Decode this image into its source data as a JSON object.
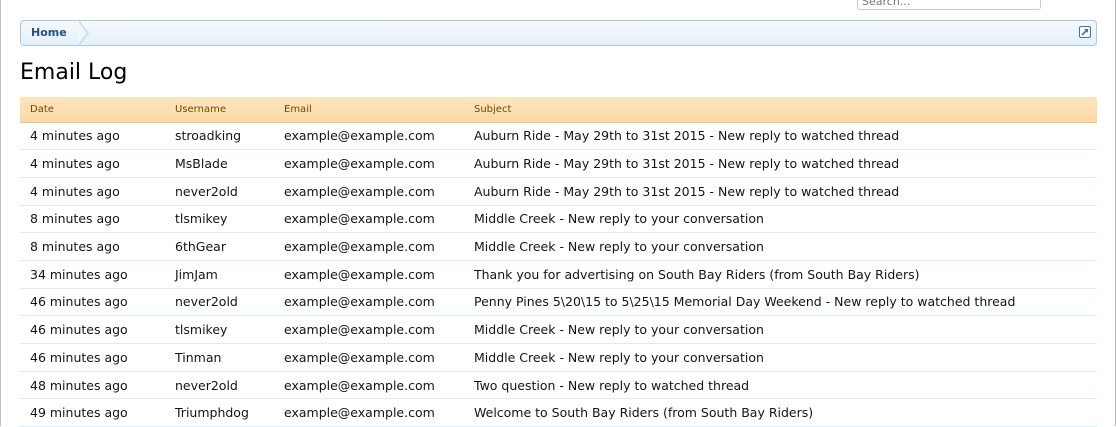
{
  "search": {
    "placeholder": "Search..."
  },
  "breadcrumb": {
    "home_label": "Home"
  },
  "page": {
    "title": "Email Log"
  },
  "table": {
    "columns": [
      "Date",
      "Username",
      "Email",
      "Subject"
    ],
    "rows": [
      [
        "4 minutes ago",
        "stroadking",
        "example@example.com",
        "Auburn Ride - May 29th to 31st 2015 - New reply to watched thread"
      ],
      [
        "4 minutes ago",
        "MsBlade",
        "example@example.com",
        "Auburn Ride - May 29th to 31st 2015 - New reply to watched thread"
      ],
      [
        "4 minutes ago",
        "never2old",
        "example@example.com",
        "Auburn Ride - May 29th to 31st 2015 - New reply to watched thread"
      ],
      [
        "8 minutes ago",
        "tlsmikey",
        "example@example.com",
        "Middle Creek - New reply to your conversation"
      ],
      [
        "8 minutes ago",
        "6thGear",
        "example@example.com",
        "Middle Creek - New reply to your conversation"
      ],
      [
        "34 minutes ago",
        "JimJam",
        "example@example.com",
        "Thank you for advertising on South Bay Riders (from South Bay Riders)"
      ],
      [
        "46 minutes ago",
        "never2old",
        "example@example.com",
        "Penny Pines 5\\20\\15 to 5\\25\\15 Memorial Day Weekend - New reply to watched thread"
      ],
      [
        "46 minutes ago",
        "tlsmikey",
        "example@example.com",
        "Middle Creek - New reply to your conversation"
      ],
      [
        "46 minutes ago",
        "Tinman",
        "example@example.com",
        "Middle Creek - New reply to your conversation"
      ],
      [
        "48 minutes ago",
        "never2old",
        "example@example.com",
        "Two question - New reply to watched thread"
      ],
      [
        "49 minutes ago",
        "Triumphdog",
        "example@example.com",
        "Welcome to South Bay Riders (from South Bay Riders)"
      ]
    ]
  },
  "icons": {
    "breadcrumb_jump": "external-link-icon"
  },
  "colors": {
    "header_bg": "#fbd9a4",
    "header_text": "#6a4a00",
    "breadcrumb_border": "#a5cae4",
    "link": "#22518a",
    "row_divider": "#d7edfc"
  }
}
